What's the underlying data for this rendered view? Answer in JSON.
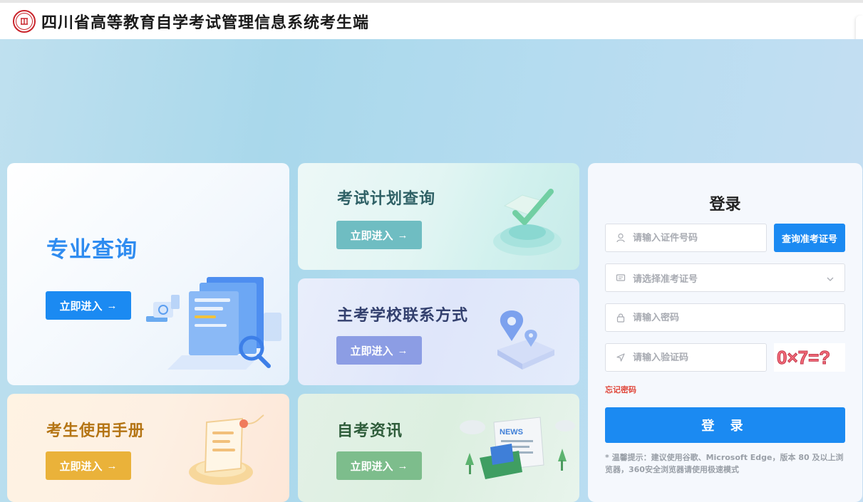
{
  "header": {
    "title": "四川省高等教育自学考试管理信息系统考生端",
    "logo_icon": "university-seal-icon"
  },
  "cards": {
    "major": {
      "title": "专业查询",
      "button": "立即进入",
      "arrow": "→"
    },
    "plan": {
      "title": "考试计划查询",
      "button": "立即进入",
      "arrow": "→"
    },
    "school": {
      "title": "主考学校联系方式",
      "button": "立即进入",
      "arrow": "→"
    },
    "manual": {
      "title": "考生使用手册",
      "button": "立即进入",
      "arrow": "→"
    },
    "news": {
      "title": "自考资讯",
      "button": "立即进入",
      "arrow": "→"
    }
  },
  "login": {
    "title": "登录",
    "id_placeholder": "请输入证件号码",
    "query_button": "查询准考证号",
    "ticket_placeholder": "请选择准考证号",
    "password_placeholder": "请输入密码",
    "captcha_placeholder": "请输入验证码",
    "captcha_text": "0×7=?",
    "forgot": "忘记密码",
    "submit": "登 录",
    "tip": "* 温馨提示：建议使用谷歌、Microsoft Edge，版本 80 及以上浏览器，360安全浏览器请使用极速模式"
  },
  "colors": {
    "primary": "#1b8af2",
    "plan": "#6fbdc2",
    "school": "#8c9de4",
    "manual": "#eab23a",
    "news": "#7dbd8c",
    "forgot": "#e0473b"
  }
}
